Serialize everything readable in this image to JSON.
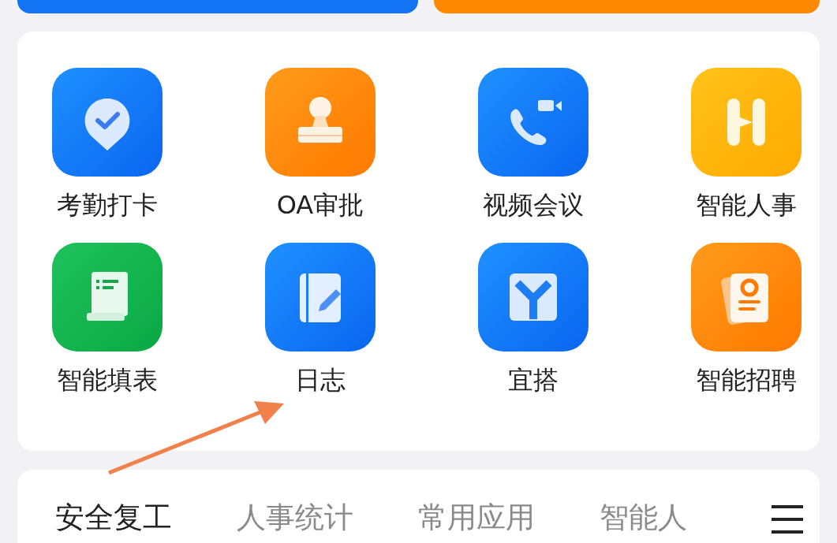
{
  "apps": [
    {
      "label": "考勤打卡"
    },
    {
      "label": "OA审批"
    },
    {
      "label": "视频会议"
    },
    {
      "label": "智能人事"
    },
    {
      "label": "智能填表"
    },
    {
      "label": "日志"
    },
    {
      "label": "宜搭"
    },
    {
      "label": "智能招聘"
    }
  ],
  "tabs": [
    {
      "label": "安全复工",
      "selected": true
    },
    {
      "label": "人事统计",
      "selected": false
    },
    {
      "label": "常用应用",
      "selected": false
    },
    {
      "label": "智能人",
      "selected": false
    }
  ]
}
